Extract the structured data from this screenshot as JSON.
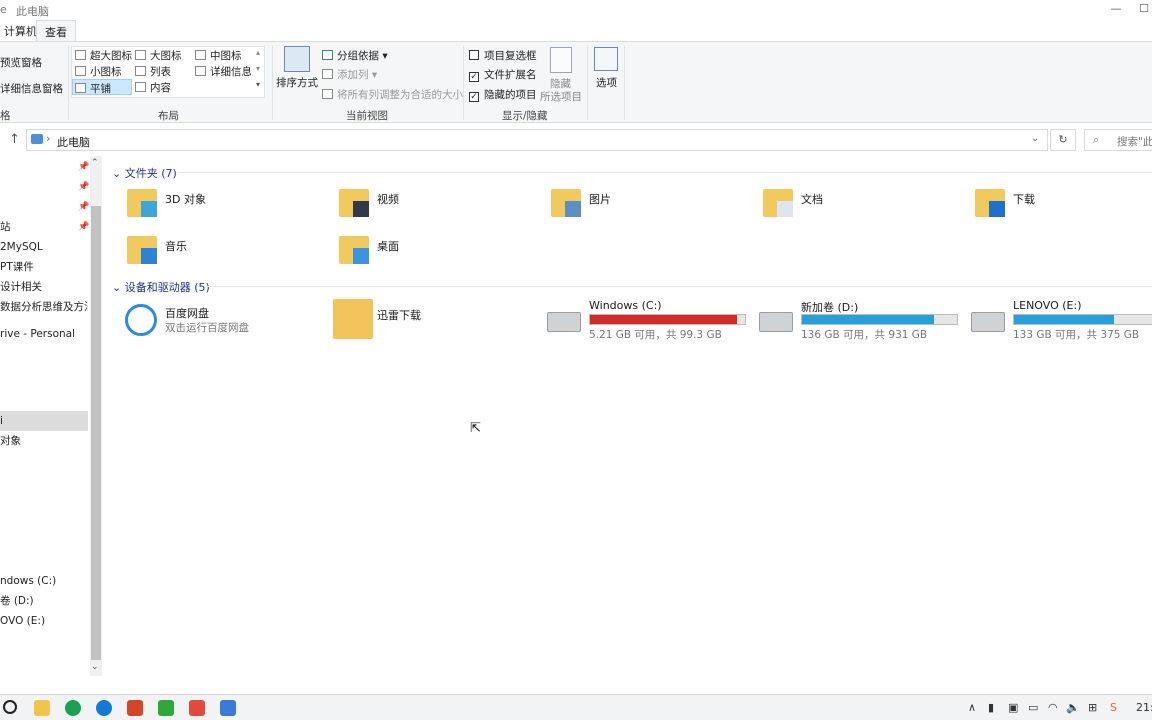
{
  "window": {
    "title": "此电脑",
    "menu_fragment": "e"
  },
  "tabs": [
    {
      "label": "计算机"
    },
    {
      "label": "查看"
    }
  ],
  "ribbon": {
    "pane": {
      "preview": "预览窗格",
      "details": "详细信息窗格",
      "label_fragment": "格"
    },
    "layout": {
      "items": [
        "超大图标",
        "大图标",
        "中图标",
        "小图标",
        "列表",
        "详细信息",
        "平铺",
        "内容"
      ],
      "label": "布局"
    },
    "current_view": {
      "sort": "排序方式",
      "group_by": "分组依据",
      "add_column": "添加列",
      "fit_columns": "将所有列调整为合适的大小",
      "label": "当前视图"
    },
    "show_hide": {
      "item_checkboxes": "项目复选框",
      "file_extensions": "文件扩展名",
      "hidden_items": "隐藏的项目",
      "hide_selected_1": "隐藏",
      "hide_selected_2": "所选项目",
      "label": "显示/隐藏",
      "checks": {
        "item_checkboxes": false,
        "file_extensions": true,
        "hidden_items": true
      }
    },
    "options": "选项"
  },
  "address": {
    "path": "此电脑",
    "search_placeholder": "搜索\"此"
  },
  "nav": {
    "items": [
      "站",
      "2MySQL",
      "PT课件",
      "设计相关",
      "数据分析思维及方法论",
      "rive - Personal",
      "i",
      "对象",
      "ndows (C:)",
      "卷 (D:)",
      "OVO (E:)"
    ]
  },
  "folders": {
    "header": "文件夹 (7)",
    "items": [
      "3D 对象",
      "视频",
      "图片",
      "文档",
      "下载",
      "音乐",
      "桌面"
    ]
  },
  "devices": {
    "header": "设备和驱动器 (5)",
    "apps": [
      {
        "name": "百度网盘",
        "sub": "双击运行百度网盘"
      },
      {
        "name": "迅雷下载",
        "sub": ""
      }
    ],
    "drives": [
      {
        "name": "Windows (C:)",
        "sub": "5.21 GB 可用，共 99.3 GB",
        "used": 0.948,
        "color": "#d42a2a"
      },
      {
        "name": "新加卷 (D:)",
        "sub": "136 GB 可用，共 931 GB",
        "used": 0.854,
        "color": "#26a0da"
      },
      {
        "name": "LENOVO (E:)",
        "sub": "133 GB 可用，共 375 GB",
        "used": 0.645,
        "color": "#26a0da"
      }
    ]
  },
  "taskbar": {
    "clock": "21:"
  }
}
